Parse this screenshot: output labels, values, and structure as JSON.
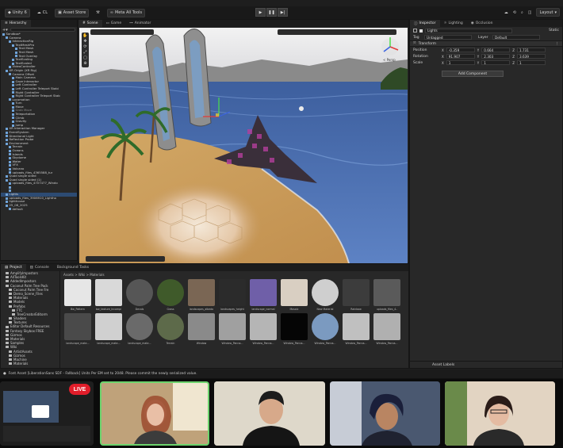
{
  "toolbar": {
    "account": "Unity 6",
    "cloud": "CL",
    "asset_store": "Asset Store",
    "meta_tools": "Meta All Tools",
    "layout": "Layout"
  },
  "hierarchy": {
    "tab": "Hierarchy",
    "rows": [
      {
        "text": "Sandbox*",
        "indent": 0,
        "sel": false,
        "dim": false
      },
      {
        "text": "Camera",
        "indent": 1,
        "sel": false,
        "dim": false
      },
      {
        "text": "InteractionRig",
        "indent": 2,
        "sel": false,
        "dim": false
      },
      {
        "text": "TextMeshPro",
        "indent": 3,
        "sel": false,
        "dim": false
      },
      {
        "text": "Text Mesh",
        "indent": 4,
        "sel": false,
        "dim": false
      },
      {
        "text": "Text Mesh",
        "indent": 4,
        "sel": false,
        "dim": false
      },
      {
        "text": "Text Overlay",
        "indent": 4,
        "sel": false,
        "dim": false
      },
      {
        "text": "TextScaling",
        "indent": 3,
        "sel": false,
        "dim": false
      },
      {
        "text": "TextScaled",
        "indent": 3,
        "sel": false,
        "dim": false
      },
      {
        "text": "VideoController",
        "indent": 2,
        "sel": false,
        "dim": false
      },
      {
        "text": "XR Origin (XR Rig)",
        "indent": 1,
        "sel": false,
        "dim": false
      },
      {
        "text": "Camera Offset",
        "indent": 2,
        "sel": false,
        "dim": false
      },
      {
        "text": "Main Camera",
        "indent": 3,
        "sel": false,
        "dim": false
      },
      {
        "text": "Gaze Interactor",
        "indent": 3,
        "sel": false,
        "dim": false
      },
      {
        "text": "Left Controller",
        "indent": 3,
        "sel": false,
        "dim": false
      },
      {
        "text": "Left Controller Teleport Stabi",
        "indent": 3,
        "sel": false,
        "dim": false
      },
      {
        "text": "Right Controller",
        "indent": 3,
        "sel": false,
        "dim": false
      },
      {
        "text": "Right Controller Teleport Stab",
        "indent": 3,
        "sel": false,
        "dim": false
      },
      {
        "text": "Locomotion",
        "indent": 2,
        "sel": false,
        "dim": false
      },
      {
        "text": "Turn",
        "indent": 3,
        "sel": false,
        "dim": false
      },
      {
        "text": "Move",
        "indent": 3,
        "sel": false,
        "dim": false
      },
      {
        "text": "Grab Move",
        "indent": 3,
        "sel": false,
        "dim": true
      },
      {
        "text": "Teleportation",
        "indent": 3,
        "sel": false,
        "dim": false
      },
      {
        "text": "Climb",
        "indent": 3,
        "sel": false,
        "dim": false
      },
      {
        "text": "Gravity",
        "indent": 3,
        "sel": false,
        "dim": false
      },
      {
        "text": "Jump",
        "indent": 3,
        "sel": false,
        "dim": false
      },
      {
        "text": "XR Interaction Manager",
        "indent": 1,
        "sel": false,
        "dim": false
      },
      {
        "text": "EventSystem",
        "indent": 1,
        "sel": false,
        "dim": false
      },
      {
        "text": "Directional Light",
        "indent": 1,
        "sel": false,
        "dim": false
      },
      {
        "text": "Reflection Probe",
        "indent": 1,
        "sel": false,
        "dim": false
      },
      {
        "text": "Environment",
        "indent": 1,
        "sel": false,
        "dim": false
      },
      {
        "text": "Terrain",
        "indent": 2,
        "sel": false,
        "dim": false
      },
      {
        "text": "Oceans",
        "indent": 2,
        "sel": false,
        "dim": false
      },
      {
        "text": "Islands",
        "indent": 2,
        "sel": false,
        "dim": false
      },
      {
        "text": "Skydome",
        "indent": 2,
        "sel": false,
        "dim": false
      },
      {
        "text": "Water",
        "indent": 2,
        "sel": false,
        "dim": false
      },
      {
        "text": "VFX",
        "indent": 2,
        "sel": false,
        "dim": false
      },
      {
        "text": "Volcano",
        "indent": 2,
        "sel": false,
        "dim": false
      },
      {
        "text": "uploads_files_4365588_tur",
        "indent": 2,
        "sel": false,
        "dim": false
      },
      {
        "text": "Quad single sided",
        "indent": 1,
        "sel": false,
        "dim": false
      },
      {
        "text": "Quad single sided (1)",
        "indent": 1,
        "sel": false,
        "dim": false
      },
      {
        "text": "uploads_files_4707477_Windo",
        "indent": 2,
        "sel": false,
        "dim": false
      },
      {
        "text": "",
        "indent": 2,
        "sel": false,
        "dim": false
      },
      {
        "text": "",
        "indent": 2,
        "sel": false,
        "dim": false
      },
      {
        "text": "Lights",
        "indent": 1,
        "sel": true,
        "dim": false
      },
      {
        "text": "uploads_files_3906910_Lightho",
        "indent": 1,
        "sel": false,
        "dim": false
      },
      {
        "text": "lighthouse",
        "indent": 1,
        "sel": false,
        "dim": false
      },
      {
        "text": "25_08_2025",
        "indent": 1,
        "sel": false,
        "dim": false
      },
      {
        "text": "default",
        "indent": 2,
        "sel": false,
        "dim": false
      }
    ]
  },
  "scene": {
    "tabs": [
      "Scene",
      "Game",
      "Animator"
    ],
    "persp_label": "< Persp"
  },
  "inspector": {
    "tabs": [
      "Inspector",
      "Lighting",
      "Occlusion"
    ],
    "object_name": "Lights",
    "static_label": "Static",
    "tag_label": "Tag",
    "tag_value": "Untagged",
    "layer_label": "Layer",
    "layer_value": "Default",
    "component": "Transform",
    "position_label": "Position",
    "rotation_label": "Rotation",
    "scale_label": "Scale",
    "position": [
      "-0.359",
      "0.664",
      "1.731"
    ],
    "rotation": [
      "91.907",
      "2.303",
      "3.639"
    ],
    "scale": [
      "1",
      "1",
      "1"
    ],
    "add_component": "Add Component",
    "asset_labels": "Asset Labels"
  },
  "project": {
    "tabs": [
      "Project",
      "Console",
      "Background Tasks"
    ],
    "breadcrumb": "Assets > Wiki > Materials",
    "tree": [
      {
        "text": "AmplifyImpostors",
        "indent": 1
      },
      {
        "text": "AllToolsKit",
        "indent": 1
      },
      {
        "text": "AddedImpostors",
        "indent": 1
      },
      {
        "text": "Coconut Palm Tree Pack",
        "indent": 1
      },
      {
        "text": "Coconut Palm Tree Fre",
        "indent": 2
      },
      {
        "text": "Demo_Scene_Files",
        "indent": 2
      },
      {
        "text": "Materials",
        "indent": 2
      },
      {
        "text": "Models",
        "indent": 2
      },
      {
        "text": "Prefabs",
        "indent": 2
      },
      {
        "text": "FTC",
        "indent": 3
      },
      {
        "text": "TreeCreatorEditorm",
        "indent": 3
      },
      {
        "text": "Shaders",
        "indent": 2
      },
      {
        "text": "Textures",
        "indent": 2
      },
      {
        "text": "Editor Default Resources",
        "indent": 1
      },
      {
        "text": "Fantasy Skybox FREE",
        "indent": 1
      },
      {
        "text": "Gizmos",
        "indent": 1
      },
      {
        "text": "Materials",
        "indent": 1
      },
      {
        "text": "Samples",
        "indent": 1
      },
      {
        "text": "Wiki",
        "indent": 1
      },
      {
        "text": "ArtistAssets",
        "indent": 2
      },
      {
        "text": "Gizmos",
        "indent": 2
      },
      {
        "text": "Machine",
        "indent": 2
      },
      {
        "text": "Materials",
        "indent": 2
      }
    ],
    "assets_row1": [
      "Bw_Pattern",
      "bw_texture_Incompl",
      "Decals",
      "Grass",
      "landscapes_albedo",
      "landscapes_height",
      "landscape_normal",
      "Mosaic",
      "New Material",
      "Rainbow",
      "uploads_files_4.."
    ],
    "assets_row2": [
      "landscape_mate...",
      "landscape_mate...",
      "landscape_mate...",
      "Terrain",
      "Window",
      "Window_Panna...",
      "Window_Panna...",
      "Window_Panna...",
      "Window_Panna...",
      "Window_Panna...",
      "Window_Panna..."
    ]
  },
  "status": {
    "message": "Font Asset [LiberationSans SDF - Fallback] Units Per EM set to 2048. Please commit the newly serialized value."
  },
  "call": {
    "live_label": "LIVE"
  }
}
